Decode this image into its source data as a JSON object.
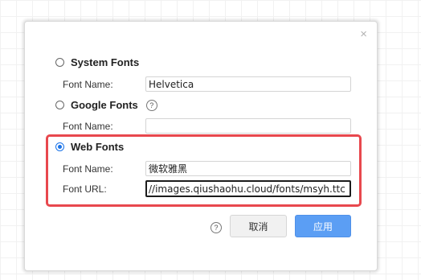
{
  "dialog": {
    "close_icon": "×",
    "system_fonts": {
      "label": "System Fonts",
      "font_name_label": "Font Name:",
      "font_name_value": "Helvetica",
      "checked": false
    },
    "google_fonts": {
      "label": "Google Fonts",
      "help_icon": "?",
      "font_name_label": "Font Name:",
      "font_name_value": "",
      "checked": false
    },
    "web_fonts": {
      "label": "Web Fonts",
      "font_name_label": "Font Name:",
      "font_name_value": "微软雅黑",
      "font_url_label": "Font URL:",
      "font_url_value": "//images.qiushaohu.cloud/fonts/msyh.ttc",
      "checked": true
    },
    "footer": {
      "help_icon": "?",
      "cancel_label": "取消",
      "apply_label": "应用"
    }
  },
  "colors": {
    "highlight": "#e8484e",
    "apply_button": "#5b9ef4",
    "radio_checked": "#1a73e8"
  }
}
